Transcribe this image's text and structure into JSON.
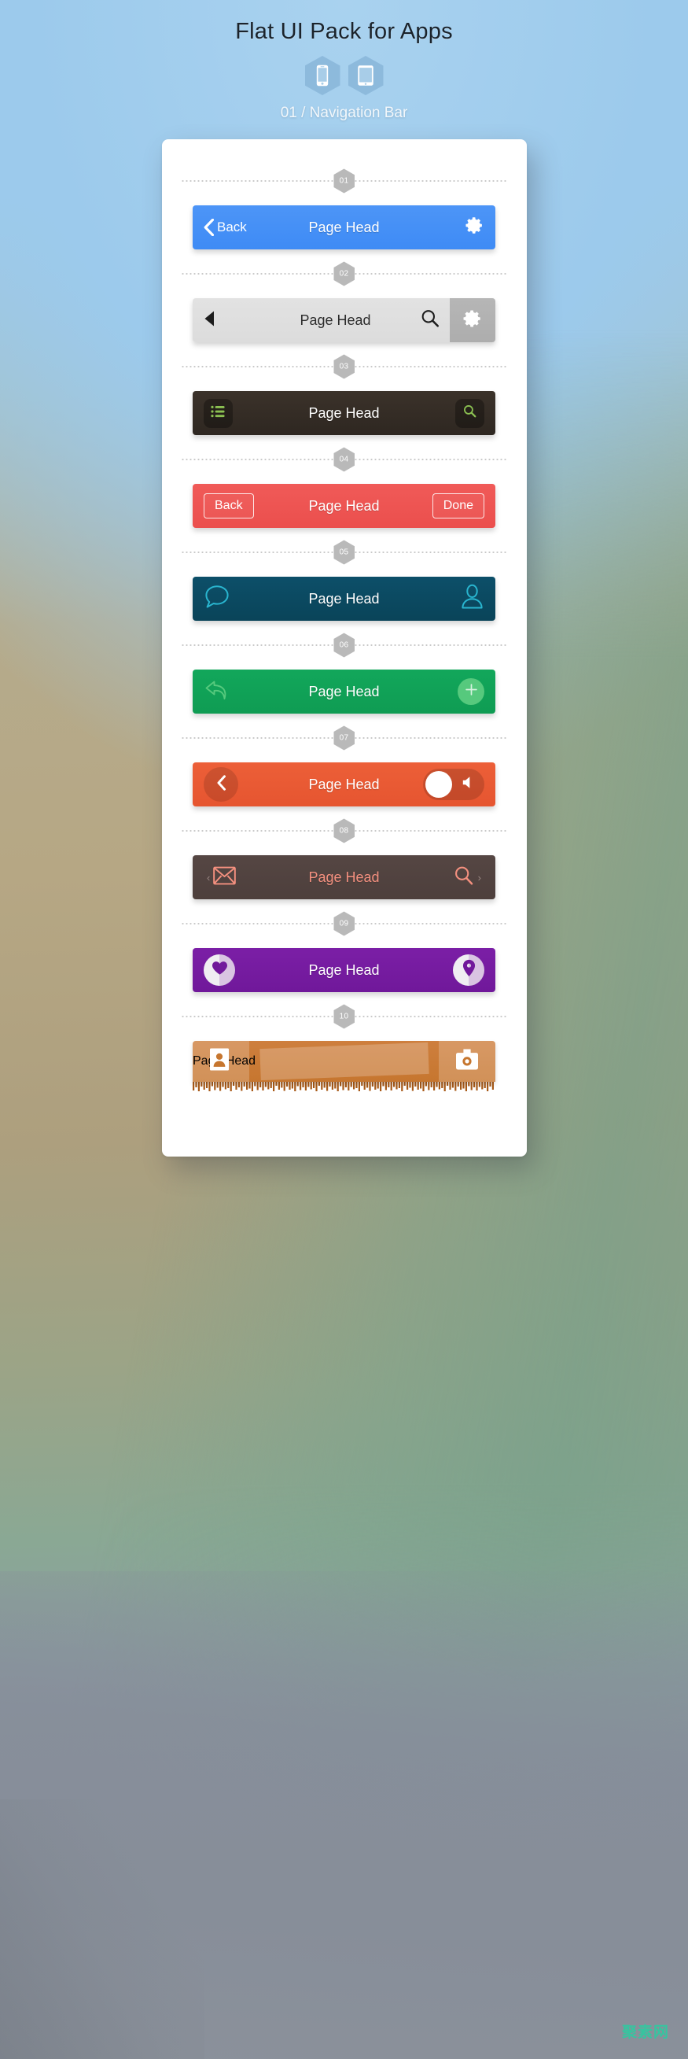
{
  "header": {
    "title": "Flat UI Pack for Apps",
    "subtitle": "01 / Navigation Bar",
    "devices": [
      {
        "name": "phone-icon",
        "label": "phone"
      },
      {
        "name": "tablet-icon",
        "label": "tablet"
      }
    ]
  },
  "colors": {
    "bar01": "#3e8bf5",
    "bar02": "#dcdcdc",
    "bar02_gear_pane": "#b0b0b0",
    "bar03": "#2e2721",
    "bar03_accent": "#8cc152",
    "bar04": "#eb4f4d",
    "bar05": "#0a4459",
    "bar05_accent": "#29b5cf",
    "bar06": "#0f9c53",
    "bar06_accent": "#56c97d",
    "bar07": "#e65530",
    "bar08": "#4d3f3c",
    "bar08_accent": "#f4907f",
    "bar09": "#70189a",
    "bar10": "#c6762f",
    "divider_hex": "#b9b9b9",
    "watermark": "#31c9a0"
  },
  "bars": [
    {
      "index": "01",
      "title": "Page Head",
      "back_label": "Back",
      "left_icon": "chevron-left-icon",
      "right_icon": "gear-icon",
      "style": "bar01"
    },
    {
      "index": "02",
      "title": "Page Head",
      "left_icon": "triangle-left-icon",
      "right_icon": "search-icon",
      "extra_icon": "gear-icon",
      "style": "bar02"
    },
    {
      "index": "03",
      "title": "Page Head",
      "left_icon": "list-icon",
      "right_icon": "search-icon",
      "style": "bar03"
    },
    {
      "index": "04",
      "title": "Page Head",
      "back_label": "Back",
      "done_label": "Done",
      "style": "bar04"
    },
    {
      "index": "05",
      "title": "Page Head",
      "left_icon": "chat-bubble-icon",
      "right_icon": "user-icon",
      "style": "bar05"
    },
    {
      "index": "06",
      "title": "Page Head",
      "left_icon": "reply-arrow-icon",
      "right_icon": "plus-icon",
      "style": "bar06"
    },
    {
      "index": "07",
      "title": "Page Head",
      "left_icon": "chevron-left-icon",
      "right_icon": "speaker-icon",
      "toggle_state": "on",
      "style": "bar07"
    },
    {
      "index": "08",
      "title": "Page Head",
      "left_icon": "envelope-icon",
      "right_icon": "search-icon",
      "style": "bar08"
    },
    {
      "index": "09",
      "title": "Page Head",
      "left_icon": "heart-icon",
      "right_icon": "map-pin-icon",
      "style": "bar09"
    },
    {
      "index": "10",
      "title": "Page Head",
      "left_icon": "contact-card-icon",
      "right_icon": "camera-icon",
      "style": "bar10"
    }
  ],
  "watermark": {
    "text": "聚素网"
  }
}
